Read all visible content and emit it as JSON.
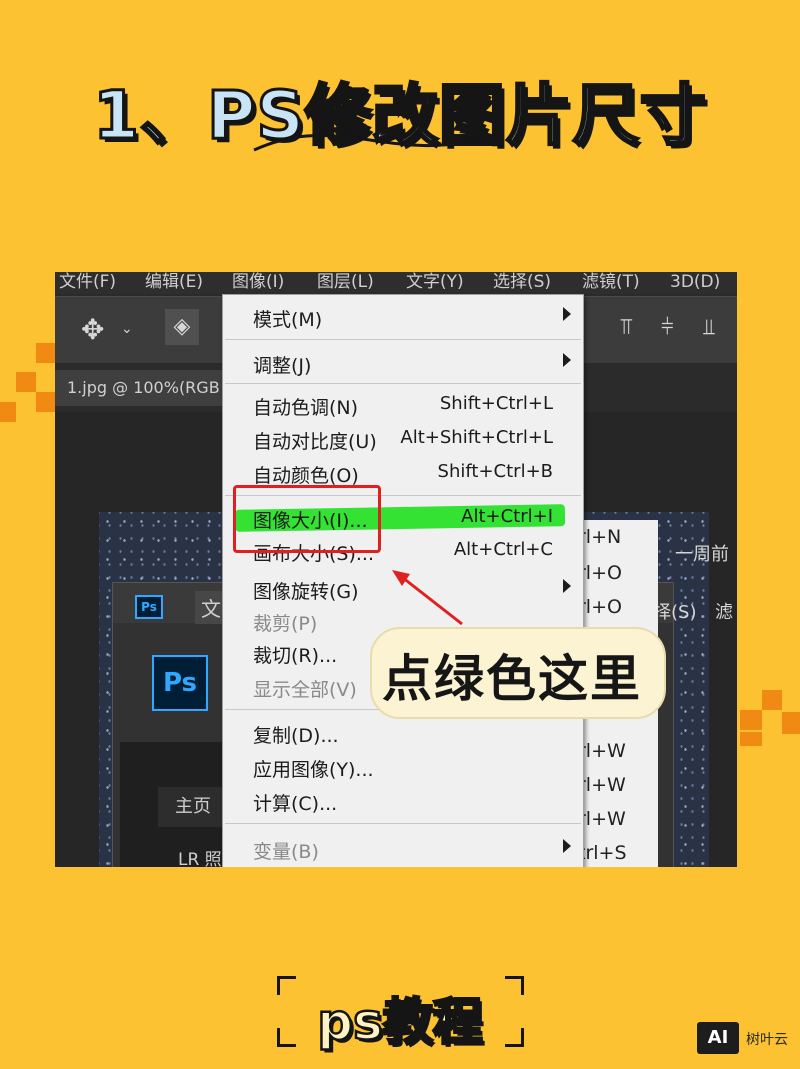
{
  "title": "1、PS修改图片尺寸",
  "menubar": [
    "文件(F)",
    "编辑(E)",
    "图像(I)",
    "图层(L)",
    "文字(Y)",
    "选择(S)",
    "滤镜(T)",
    "3D(D)"
  ],
  "doc_tab": "1.jpg @ 100%(RGB",
  "menu_items": [
    {
      "label": "模式(M)",
      "shortcut": "",
      "submenu": true,
      "disabled": false
    },
    {
      "label": "调整(J)",
      "shortcut": "",
      "submenu": true,
      "disabled": false
    },
    {
      "label": "自动色调(N)",
      "shortcut": "Shift+Ctrl+L",
      "submenu": false,
      "disabled": false
    },
    {
      "label": "自动对比度(U)",
      "shortcut": "Alt+Shift+Ctrl+L",
      "submenu": false,
      "disabled": false
    },
    {
      "label": "自动颜色(O)",
      "shortcut": "Shift+Ctrl+B",
      "submenu": false,
      "disabled": false
    },
    {
      "label": "图像大小(I)...",
      "shortcut": "Alt+Ctrl+I",
      "submenu": false,
      "disabled": false
    },
    {
      "label": "画布大小(S)...",
      "shortcut": "Alt+Ctrl+C",
      "submenu": false,
      "disabled": false
    },
    {
      "label": "图像旋转(G)",
      "shortcut": "",
      "submenu": true,
      "disabled": false
    },
    {
      "label": "裁剪(P)",
      "shortcut": "",
      "submenu": false,
      "disabled": true
    },
    {
      "label": "裁切(R)...",
      "shortcut": "",
      "submenu": false,
      "disabled": false
    },
    {
      "label": "显示全部(V)",
      "shortcut": "",
      "submenu": false,
      "disabled": true
    },
    {
      "label": "复制(D)...",
      "shortcut": "",
      "submenu": false,
      "disabled": false
    },
    {
      "label": "应用图像(Y)...",
      "shortcut": "",
      "submenu": false,
      "disabled": false
    },
    {
      "label": "计算(C)...",
      "shortcut": "",
      "submenu": false,
      "disabled": false
    },
    {
      "label": "变量(B)",
      "shortcut": "",
      "submenu": true,
      "disabled": true
    }
  ],
  "submenu_partial": [
    "rl+N",
    "rl+O",
    "rl+O",
    "rl+W",
    "rl+W",
    "rl+W",
    "trl+S"
  ],
  "side_texts": {
    "week": "一周前",
    "select": "择(S)",
    "filter": "滤"
  },
  "inner_window": {
    "file_menu": "文",
    "ps_logo": "Ps",
    "home": "主页",
    "lr": "LR 照"
  },
  "annotation": "点绿色这里",
  "bottom_label": "ps教程",
  "watermark": {
    "logo": "AI",
    "text": "树叶云"
  },
  "colors": {
    "background": "#fcc231",
    "highlight": "#1ee01e",
    "box": "#e02020",
    "ps_blue": "#31a8ff"
  }
}
